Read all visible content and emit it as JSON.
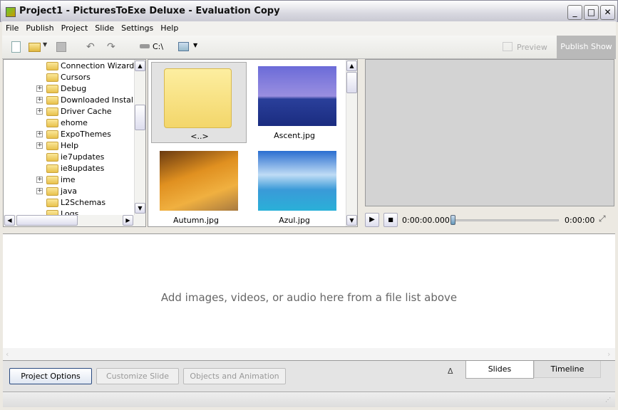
{
  "window": {
    "title": "Project1 - PicturesToExe Deluxe - Evaluation Copy",
    "min": "_",
    "max": "□",
    "close": "✕"
  },
  "menu": [
    "File",
    "Publish",
    "Project",
    "Slide",
    "Settings",
    "Help"
  ],
  "toolbar": {
    "drive": "C:\\",
    "preview": "Preview",
    "publish_show": "Publish Show"
  },
  "tree": [
    {
      "label": "Connection Wizard",
      "expand": false
    },
    {
      "label": "Cursors",
      "expand": false
    },
    {
      "label": "Debug",
      "expand": true
    },
    {
      "label": "Downloaded Installati",
      "expand": true
    },
    {
      "label": "Driver Cache",
      "expand": true
    },
    {
      "label": "ehome",
      "expand": false
    },
    {
      "label": "ExpoThemes",
      "expand": true
    },
    {
      "label": "Help",
      "expand": true
    },
    {
      "label": "ie7updates",
      "expand": false
    },
    {
      "label": "ie8updates",
      "expand": false
    },
    {
      "label": "ime",
      "expand": true
    },
    {
      "label": "java",
      "expand": true
    },
    {
      "label": "L2Schemas",
      "expand": false
    },
    {
      "label": "Logs",
      "expand": false
    }
  ],
  "files": [
    {
      "name": "<..>"
    },
    {
      "name": "Ascent.jpg"
    },
    {
      "name": "Autumn.jpg"
    },
    {
      "name": "Azul.jpg"
    }
  ],
  "player": {
    "position": "0:00:00.000",
    "duration": "0:00:00",
    "progress": 0
  },
  "drop_hint": "Add images, videos, or audio here from a file list above",
  "bottom": {
    "project_options": "Project Options",
    "customize_slide": "Customize Slide",
    "objects_animation": "Objects and Animation",
    "collapse": "Δ",
    "tab_slides": "Slides",
    "tab_timeline": "Timeline"
  }
}
